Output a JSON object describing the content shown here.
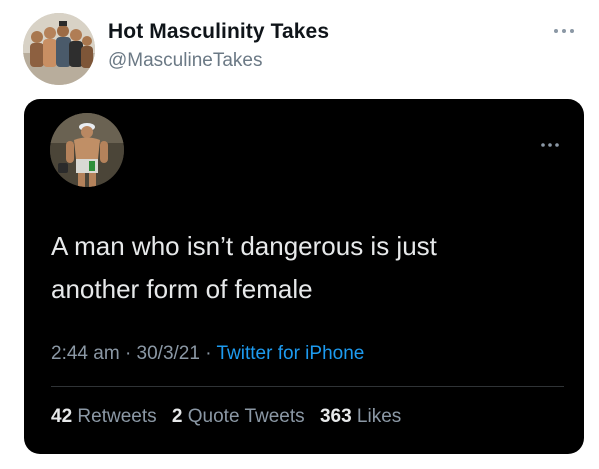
{
  "outer_tweet": {
    "display_name": "Hot Masculinity Takes",
    "handle": "@MasculineTakes",
    "more_icon": "ellipsis-icon"
  },
  "embedded_tweet": {
    "more_icon": "ellipsis-icon",
    "text_line1": "A man who isn’t dangerous is just",
    "text_line2": "another form of female",
    "time": "2:44 am",
    "separator": "·",
    "date": "30/3/21",
    "source": "Twitter for iPhone",
    "stats": {
      "retweets_count": "42",
      "retweets_label": "Retweets",
      "quotes_count": "2",
      "quotes_label": "Quote Tweets",
      "likes_count": "363",
      "likes_label": "Likes"
    }
  },
  "colors": {
    "card_bg": "#000000",
    "link_blue": "#1d9bf0",
    "muted_gray": "#8b98a5"
  }
}
